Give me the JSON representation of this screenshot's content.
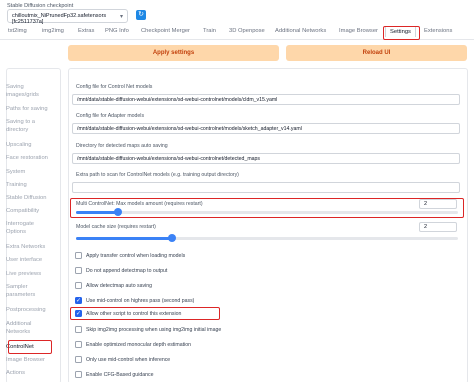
{
  "checkpoint": {
    "label": "Stable Diffusion checkpoint",
    "value": "chilloutmix_NiPrunedFp32.safetensors [fc2511737a]",
    "refresh_icon": "refresh-icon"
  },
  "tabs": [
    "txt2img",
    "img2img",
    "Extras",
    "PNG Info",
    "Checkpoint Merger",
    "Train",
    "3D Openpose",
    "Additional Networks",
    "Image Browser",
    "Settings",
    "Extensions"
  ],
  "buttons": {
    "apply": "Apply settings",
    "reload": "Reload UI"
  },
  "sidebar": [
    "Saving images/grids",
    "Paths for saving",
    "Saving to a directory",
    "Upscaling",
    "Face restoration",
    "System",
    "Training",
    "Stable Diffusion",
    "Compatibility",
    "Interrogate Options",
    "Extra Networks",
    "User interface",
    "Live previews",
    "Sampler parameters",
    "Postprocessing",
    "Additional Networks",
    "ControlNet",
    "Image Browser",
    "Actions"
  ],
  "fields": [
    {
      "label": "Config file for Control Net models",
      "value": "/mnt/data/stable-diffusion-webui/extensions/sd-webui-controlnet/models/cldm_v15.yaml"
    },
    {
      "label": "Config file for Adapter models",
      "value": "/mnt/data/stable-diffusion-webui/extensions/sd-webui-controlnet/models/sketch_adapter_v14.yaml"
    },
    {
      "label": "Directory for detected maps auto saving",
      "value": "/mnt/data/stable-diffusion-webui/extensions/sd-webui-controlnet/detected_maps"
    },
    {
      "label": "Extra path to scan for ControlNet models (e.g. training output directory)",
      "value": ""
    }
  ],
  "sliders": [
    {
      "label": "Multi ControlNet: Max models amount (requires restart)",
      "value": 2,
      "min": 1,
      "max": 10
    },
    {
      "label": "Model cache size (requires restart)",
      "value": 2,
      "min": 1,
      "max": 5
    }
  ],
  "checkboxes": [
    {
      "label": "Apply transfer control when loading models",
      "checked": false
    },
    {
      "label": "Do not append detectmap to output",
      "checked": false
    },
    {
      "label": "Allow detectmap auto saving",
      "checked": false
    },
    {
      "label": "Use mid-control on highres pass (second pass)",
      "checked": true
    },
    {
      "label": "Allow other script to control this extension",
      "checked": true
    },
    {
      "label": "Skip img2img processing when using img2img initial image",
      "checked": false
    },
    {
      "label": "Enable optimized monocular depth estimation",
      "checked": false
    },
    {
      "label": "Only use mid-control when inference",
      "checked": false
    },
    {
      "label": "Enable CFG-Based guidance",
      "checked": false
    }
  ],
  "colors": {
    "accent": "#f97316",
    "highlight": "#dc2626",
    "slider": "#3b82f6"
  }
}
